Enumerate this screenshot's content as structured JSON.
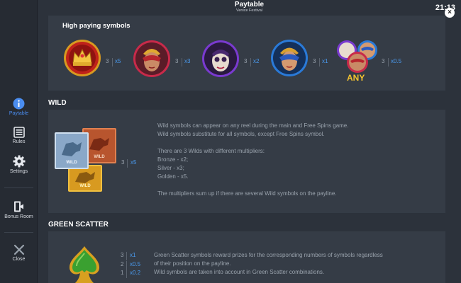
{
  "header": {
    "title": "Paytable",
    "subtitle": "Venice Festival",
    "time": "21:13"
  },
  "sidebar": {
    "items": [
      {
        "label": "Paytable",
        "icon": "info-icon",
        "active": true
      },
      {
        "label": "Rules",
        "icon": "list-icon"
      },
      {
        "label": "Settings",
        "icon": "gear-icon"
      },
      {
        "label": "Bonus Room",
        "icon": "exit-door-icon"
      },
      {
        "label": "Close",
        "icon": "close-icon"
      }
    ]
  },
  "high_paying": {
    "title": "High paying symbols",
    "symbols": [
      {
        "name": "crown-symbol",
        "count": "3",
        "mult": "x5"
      },
      {
        "name": "woman-red-mask-symbol",
        "count": "3",
        "mult": "x3"
      },
      {
        "name": "skull-mask-symbol",
        "count": "3",
        "mult": "x2"
      },
      {
        "name": "woman-blue-mask-symbol",
        "count": "3",
        "mult": "x1"
      },
      {
        "name": "any-symbol",
        "count": "3",
        "mult": "x0.5",
        "badge": "ANY"
      }
    ]
  },
  "wild": {
    "title": "WILD",
    "count": "3",
    "mult": "x5",
    "lines": [
      "Wild symbols can appear on any reel during the main and Free Spins game.",
      "Wild symbols substitute for all symbols, except Free Spins symbol.",
      "",
      "There are 3 Wilds with different multipliers:",
      "Bronze - x2;",
      "Silver - x3;",
      "Golden - x5.",
      "",
      "The multipliers sum up if there are several Wild symbols on the payline."
    ],
    "tile_labels": [
      "WILD",
      "WILD",
      "WILD"
    ]
  },
  "green_scatter": {
    "title": "GREEN SCATTER",
    "pays": [
      {
        "count": "3",
        "mult": "x1"
      },
      {
        "count": "2",
        "mult": "x0.5"
      },
      {
        "count": "1",
        "mult": "x0.2"
      }
    ],
    "lines": [
      "Green Scatter symbols reward prizes for the corresponding numbers of symbols regardless",
      "of their position on the payline.",
      "Wild symbols are taken into account in Green Scatter combinations."
    ]
  },
  "colors": {
    "accent": "#4a8df0",
    "multiplier": "#4a9bf0",
    "gold": "#f2c230"
  }
}
